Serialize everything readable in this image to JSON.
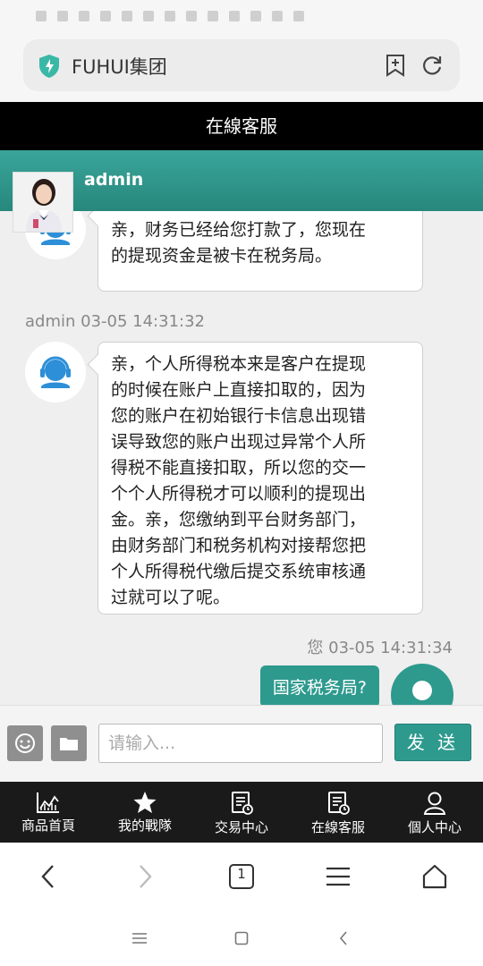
{
  "browser": {
    "url": "FUHUI集团",
    "tab_count": "1"
  },
  "page": {
    "title": "在線客服"
  },
  "chat": {
    "agent_name": "admin",
    "messages": [
      {
        "sender": "admin",
        "text_lines": [
          "亲，财务已经给您打款了，您现在",
          "的提现资金是被卡在税务局。"
        ]
      },
      {
        "sender": "admin",
        "timestamp": "admin   03-05 14:31:32",
        "text_lines": [
          "亲，个人所得税本来是客户在提现",
          "的时候在账户上直接扣取的，因为",
          "您的账户在初始银行卡信息出现错",
          "误导致您的账户出现过异常个人所",
          "得税不能直接扣取，所以您的交一",
          "个个人所得税才可以顺利的提现出",
          "金。亲，您缴纳到平台财务部门，",
          "由财务部门和税务机构对接帮您把",
          "个人所得税代缴后提交系统审核通",
          "过就可以了呢。"
        ]
      },
      {
        "sender": "me",
        "timestamp": "您   03-05 14:31:34",
        "text": "国家税务局?"
      }
    ]
  },
  "input": {
    "placeholder": "请输入...",
    "send_label": "发 送"
  },
  "nav": {
    "items": [
      {
        "label": "商品首頁",
        "icon": "chart-icon"
      },
      {
        "label": "我的戰隊",
        "icon": "star-icon"
      },
      {
        "label": "交易中心",
        "icon": "document-icon"
      },
      {
        "label": "在線客服",
        "icon": "document-icon"
      },
      {
        "label": "個人中心",
        "icon": "user-icon"
      }
    ]
  },
  "colors": {
    "accent": "#2e9a8e",
    "header_bg": "#000000",
    "nav_bg": "#1a1a1a"
  }
}
